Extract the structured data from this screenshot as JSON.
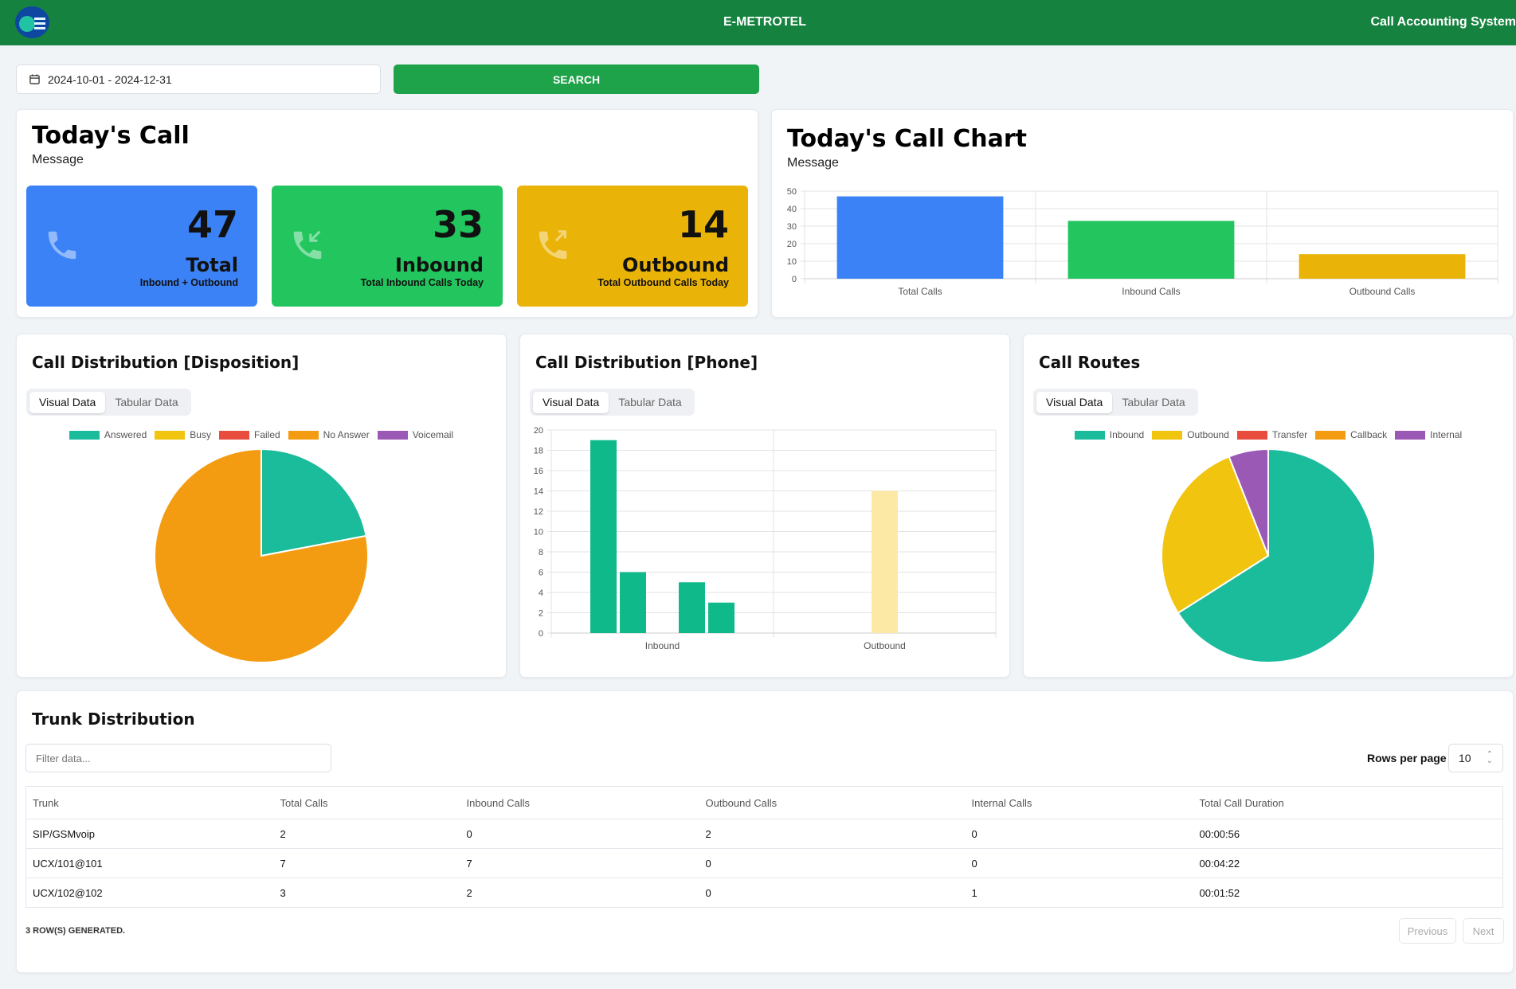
{
  "header": {
    "brand": "E-METROTEL",
    "system_name": "Call Accounting System"
  },
  "filter_bar": {
    "date_range": "2024-10-01 - 2024-12-31",
    "search_label": "SEARCH"
  },
  "todays_call": {
    "title": "Today's Call",
    "subtitle": "Message",
    "stats": [
      {
        "value": "47",
        "label": "Total",
        "desc": "Inbound + Outbound",
        "color": "#3b82f6",
        "icon": "phone-icon"
      },
      {
        "value": "33",
        "label": "Inbound",
        "desc": "Total Inbound Calls Today",
        "color": "#22c55e",
        "icon": "phone-incoming-icon"
      },
      {
        "value": "14",
        "label": "Outbound",
        "desc": "Total Outbound Calls Today",
        "color": "#eab308",
        "icon": "phone-outgoing-icon"
      }
    ]
  },
  "todays_chart": {
    "title": "Today's Call Chart",
    "subtitle": "Message"
  },
  "disposition": {
    "title": "Call Distribution [Disposition]",
    "tabs": [
      "Visual Data",
      "Tabular Data"
    ],
    "legend": [
      {
        "label": "Answered",
        "color": "#1abc9c"
      },
      {
        "label": "Busy",
        "color": "#f1c40f"
      },
      {
        "label": "Failed",
        "color": "#e74c3c"
      },
      {
        "label": "No Answer",
        "color": "#f39c12"
      },
      {
        "label": "Voicemail",
        "color": "#9b59b6"
      }
    ]
  },
  "phone": {
    "title": "Call Distribution [Phone]",
    "tabs": [
      "Visual Data",
      "Tabular Data"
    ]
  },
  "routes": {
    "title": "Call Routes",
    "tabs": [
      "Visual Data",
      "Tabular Data"
    ],
    "legend": [
      {
        "label": "Inbound",
        "color": "#1abc9c"
      },
      {
        "label": "Outbound",
        "color": "#f1c40f"
      },
      {
        "label": "Transfer",
        "color": "#e74c3c"
      },
      {
        "label": "Callback",
        "color": "#f39c12"
      },
      {
        "label": "Internal",
        "color": "#9b59b6"
      }
    ]
  },
  "trunk": {
    "title": "Trunk Distribution",
    "filter_placeholder": "Filter data...",
    "rows_per_page_label": "Rows per page",
    "rows_per_page": "10",
    "columns": [
      "Trunk",
      "Total Calls",
      "Inbound Calls",
      "Outbound Calls",
      "Internal Calls",
      "Total Call Duration"
    ],
    "rows": [
      [
        "SIP/GSMvoip",
        "2",
        "0",
        "2",
        "0",
        "00:00:56"
      ],
      [
        "UCX/101@101",
        "7",
        "7",
        "0",
        "0",
        "00:04:22"
      ],
      [
        "UCX/102@102",
        "3",
        "2",
        "0",
        "1",
        "00:01:52"
      ]
    ],
    "footer": "3 ROW(S) GENERATED.",
    "prev_label": "Previous",
    "next_label": "Next"
  },
  "chart_data": [
    {
      "type": "bar",
      "categories": [
        "Total Calls",
        "Inbound Calls",
        "Outbound Calls"
      ],
      "values": [
        47,
        33,
        14
      ],
      "colors": [
        "#3b82f6",
        "#22c55e",
        "#eab308"
      ],
      "ylim": [
        0,
        50
      ],
      "yticks": [
        0,
        10,
        20,
        30,
        40,
        50
      ],
      "legend": "none"
    },
    {
      "type": "pie",
      "labels": [
        "Answered",
        "No Answer"
      ],
      "values": [
        22,
        78
      ],
      "colors": [
        "#1abc9c",
        "#f39c12"
      ],
      "legend": "top"
    },
    {
      "type": "bar",
      "categories": [
        "Inbound",
        "Outbound"
      ],
      "series": [
        {
          "values": [
            19,
            0
          ],
          "color": "#10b98a"
        },
        {
          "values": [
            6,
            0
          ],
          "color": "#10b98a"
        },
        {
          "values": [
            0,
            14
          ],
          "color": "#fde9a6"
        },
        {
          "values": [
            5,
            0
          ],
          "color": "#10b98a"
        },
        {
          "values": [
            3,
            0
          ],
          "color": "#10b98a"
        }
      ],
      "ylim": [
        0,
        20
      ],
      "yticks": [
        0,
        2,
        4,
        6,
        8,
        10,
        12,
        14,
        16,
        18,
        20
      ],
      "legend": "none"
    },
    {
      "type": "pie",
      "labels": [
        "Inbound",
        "Outbound",
        "Internal"
      ],
      "values": [
        66,
        28,
        6
      ],
      "colors": [
        "#1abc9c",
        "#f1c40f",
        "#9b59b6"
      ],
      "legend": "top"
    }
  ]
}
